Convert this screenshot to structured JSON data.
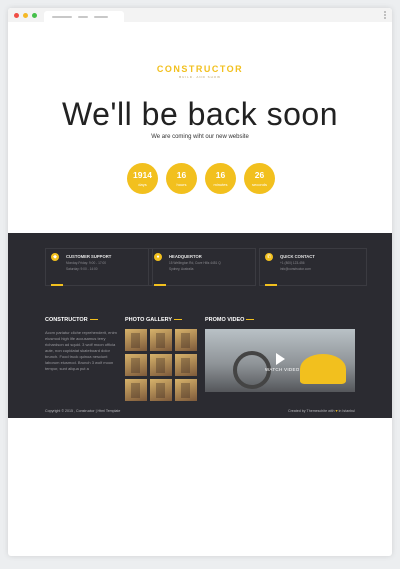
{
  "browser": {
    "dots": [
      "#f04e45",
      "#f5b927",
      "#45c04a"
    ]
  },
  "logo": {
    "text": "CONSTRUCTOR",
    "subtitle": "BUILD. AND SHOW"
  },
  "hero": {
    "headline": "We'll be back soon",
    "subline": "We are coming wiht our new website"
  },
  "countdown": [
    {
      "value": "1914",
      "label": "days"
    },
    {
      "value": "16",
      "label": "hours"
    },
    {
      "value": "16",
      "label": "minutes"
    },
    {
      "value": "26",
      "label": "seconds"
    }
  ],
  "info_boxes": [
    {
      "icon": "support-icon",
      "title": "CUSTOMER SUPPORT",
      "line1": "Monday-Friday: 9:00 - 17:00",
      "line2": "Saturday: 9:00 - 14:00"
    },
    {
      "icon": "location-icon",
      "title": "HEADQUERTOR",
      "line1": "15 Wellington Rd, Cove Hills 4451 Q",
      "line2": "Sydney, Australia"
    },
    {
      "icon": "phone-icon",
      "title": "QUICK CONTACT",
      "line1": "+1 (800) 123-456",
      "line2": "info@constructor.com"
    }
  ],
  "constructor_section": {
    "title": "CONSTRUCTOR",
    "text": "Accm pariatur cliche reprehenderit, enim eiusmod high life accusamus terry richardson ad squid. 3 wolf moon officia aute, non cupidatat skateboard dolor brunch. Food truck quinoa nesciunt laborum eiusmod. Brunch 3 wolf moon tempor, sunt aliqua put a"
  },
  "gallery": {
    "title": "PHOTO GALLERY",
    "count": 9
  },
  "promo": {
    "title": "PROMO VIDEO",
    "watch_label": "WATCH VIDEO"
  },
  "footer": {
    "copyright": "Copyright © 2015 , Constructor | Html Template",
    "credit": "Created by Themeschite with",
    "credit_suffix": "in Istanbul"
  }
}
